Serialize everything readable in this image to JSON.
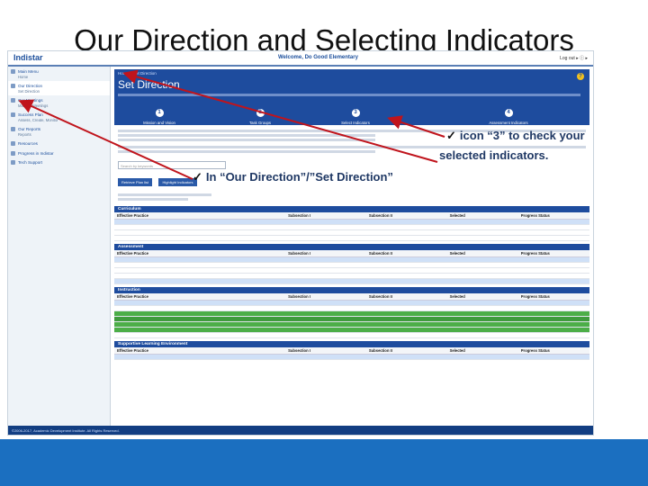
{
  "slide": {
    "title": "Our Direction and Selecting Indicators",
    "callout_icon3_line1": "icon “3” to check your",
    "callout_icon3_line2": "selected indicators.",
    "callout_icon3_prefix": "",
    "callout_direction": "In “Our Direction”/”Set Direction”",
    "check_glyph": "✓"
  },
  "app": {
    "logo": "Indistar",
    "welcome": "Welcome, Do Good Elementary",
    "top_links": "Log out ▸ ⓘ ▸",
    "breadcrumb": "Home » Set Direction",
    "panel_title": "Set Direction",
    "help_glyph": "?",
    "accent": "#1e4c9e"
  },
  "sidebar": {
    "items": [
      {
        "label": "Main Menu",
        "sub": "Home"
      },
      {
        "label": "Our Direction",
        "sub": "Set Direction"
      },
      {
        "label": "Our Meetings",
        "sub": "Manage Meetings"
      },
      {
        "label": "Success Plan",
        "sub": "Assess, Create, Monitor"
      },
      {
        "label": "Our Reports",
        "sub": "Reports"
      },
      {
        "label": "Resources",
        "sub": ""
      },
      {
        "label": "Progress in Indistar",
        "sub": ""
      },
      {
        "label": "Tech Support",
        "sub": ""
      }
    ]
  },
  "steps": [
    {
      "num": "1",
      "label": "Mission and Vision"
    },
    {
      "num": "2",
      "label": "Task Groups"
    },
    {
      "num": "3",
      "label": "Select Indicators"
    },
    {
      "num": "4",
      "label": "Assessment Indicators"
    }
  ],
  "controls": {
    "search_placeholder": "Search by keywords",
    "btn_1": "Retrieve Plan list",
    "btn_2": "Highlight Indicators"
  },
  "sections": [
    {
      "name": "Curriculum"
    },
    {
      "name": "Assessment"
    },
    {
      "name": "Instruction"
    },
    {
      "name": "Supportive Learning Environment"
    }
  ],
  "table_headers": {
    "practice": "Effective Practice",
    "sub1": "Subsection I",
    "sub2": "Subsection II",
    "selected": "Selected",
    "progress": "Progress Status"
  },
  "footer": {
    "text": "©2006-2017, Academic Development Institute. All Rights Reserved."
  }
}
